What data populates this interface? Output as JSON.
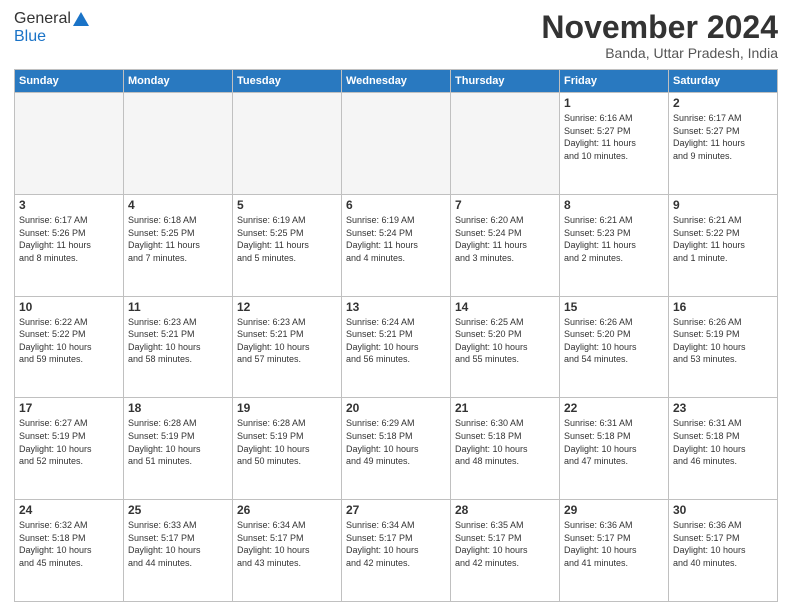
{
  "header": {
    "logo_general": "General",
    "logo_blue": "Blue",
    "month_title": "November 2024",
    "subtitle": "Banda, Uttar Pradesh, India"
  },
  "days_of_week": [
    "Sunday",
    "Monday",
    "Tuesday",
    "Wednesday",
    "Thursday",
    "Friday",
    "Saturday"
  ],
  "weeks": [
    [
      {
        "day": "",
        "info": ""
      },
      {
        "day": "",
        "info": ""
      },
      {
        "day": "",
        "info": ""
      },
      {
        "day": "",
        "info": ""
      },
      {
        "day": "",
        "info": ""
      },
      {
        "day": "1",
        "info": "Sunrise: 6:16 AM\nSunset: 5:27 PM\nDaylight: 11 hours\nand 10 minutes."
      },
      {
        "day": "2",
        "info": "Sunrise: 6:17 AM\nSunset: 5:27 PM\nDaylight: 11 hours\nand 9 minutes."
      }
    ],
    [
      {
        "day": "3",
        "info": "Sunrise: 6:17 AM\nSunset: 5:26 PM\nDaylight: 11 hours\nand 8 minutes."
      },
      {
        "day": "4",
        "info": "Sunrise: 6:18 AM\nSunset: 5:25 PM\nDaylight: 11 hours\nand 7 minutes."
      },
      {
        "day": "5",
        "info": "Sunrise: 6:19 AM\nSunset: 5:25 PM\nDaylight: 11 hours\nand 5 minutes."
      },
      {
        "day": "6",
        "info": "Sunrise: 6:19 AM\nSunset: 5:24 PM\nDaylight: 11 hours\nand 4 minutes."
      },
      {
        "day": "7",
        "info": "Sunrise: 6:20 AM\nSunset: 5:24 PM\nDaylight: 11 hours\nand 3 minutes."
      },
      {
        "day": "8",
        "info": "Sunrise: 6:21 AM\nSunset: 5:23 PM\nDaylight: 11 hours\nand 2 minutes."
      },
      {
        "day": "9",
        "info": "Sunrise: 6:21 AM\nSunset: 5:22 PM\nDaylight: 11 hours\nand 1 minute."
      }
    ],
    [
      {
        "day": "10",
        "info": "Sunrise: 6:22 AM\nSunset: 5:22 PM\nDaylight: 10 hours\nand 59 minutes."
      },
      {
        "day": "11",
        "info": "Sunrise: 6:23 AM\nSunset: 5:21 PM\nDaylight: 10 hours\nand 58 minutes."
      },
      {
        "day": "12",
        "info": "Sunrise: 6:23 AM\nSunset: 5:21 PM\nDaylight: 10 hours\nand 57 minutes."
      },
      {
        "day": "13",
        "info": "Sunrise: 6:24 AM\nSunset: 5:21 PM\nDaylight: 10 hours\nand 56 minutes."
      },
      {
        "day": "14",
        "info": "Sunrise: 6:25 AM\nSunset: 5:20 PM\nDaylight: 10 hours\nand 55 minutes."
      },
      {
        "day": "15",
        "info": "Sunrise: 6:26 AM\nSunset: 5:20 PM\nDaylight: 10 hours\nand 54 minutes."
      },
      {
        "day": "16",
        "info": "Sunrise: 6:26 AM\nSunset: 5:19 PM\nDaylight: 10 hours\nand 53 minutes."
      }
    ],
    [
      {
        "day": "17",
        "info": "Sunrise: 6:27 AM\nSunset: 5:19 PM\nDaylight: 10 hours\nand 52 minutes."
      },
      {
        "day": "18",
        "info": "Sunrise: 6:28 AM\nSunset: 5:19 PM\nDaylight: 10 hours\nand 51 minutes."
      },
      {
        "day": "19",
        "info": "Sunrise: 6:28 AM\nSunset: 5:19 PM\nDaylight: 10 hours\nand 50 minutes."
      },
      {
        "day": "20",
        "info": "Sunrise: 6:29 AM\nSunset: 5:18 PM\nDaylight: 10 hours\nand 49 minutes."
      },
      {
        "day": "21",
        "info": "Sunrise: 6:30 AM\nSunset: 5:18 PM\nDaylight: 10 hours\nand 48 minutes."
      },
      {
        "day": "22",
        "info": "Sunrise: 6:31 AM\nSunset: 5:18 PM\nDaylight: 10 hours\nand 47 minutes."
      },
      {
        "day": "23",
        "info": "Sunrise: 6:31 AM\nSunset: 5:18 PM\nDaylight: 10 hours\nand 46 minutes."
      }
    ],
    [
      {
        "day": "24",
        "info": "Sunrise: 6:32 AM\nSunset: 5:18 PM\nDaylight: 10 hours\nand 45 minutes."
      },
      {
        "day": "25",
        "info": "Sunrise: 6:33 AM\nSunset: 5:17 PM\nDaylight: 10 hours\nand 44 minutes."
      },
      {
        "day": "26",
        "info": "Sunrise: 6:34 AM\nSunset: 5:17 PM\nDaylight: 10 hours\nand 43 minutes."
      },
      {
        "day": "27",
        "info": "Sunrise: 6:34 AM\nSunset: 5:17 PM\nDaylight: 10 hours\nand 42 minutes."
      },
      {
        "day": "28",
        "info": "Sunrise: 6:35 AM\nSunset: 5:17 PM\nDaylight: 10 hours\nand 42 minutes."
      },
      {
        "day": "29",
        "info": "Sunrise: 6:36 AM\nSunset: 5:17 PM\nDaylight: 10 hours\nand 41 minutes."
      },
      {
        "day": "30",
        "info": "Sunrise: 6:36 AM\nSunset: 5:17 PM\nDaylight: 10 hours\nand 40 minutes."
      }
    ]
  ]
}
